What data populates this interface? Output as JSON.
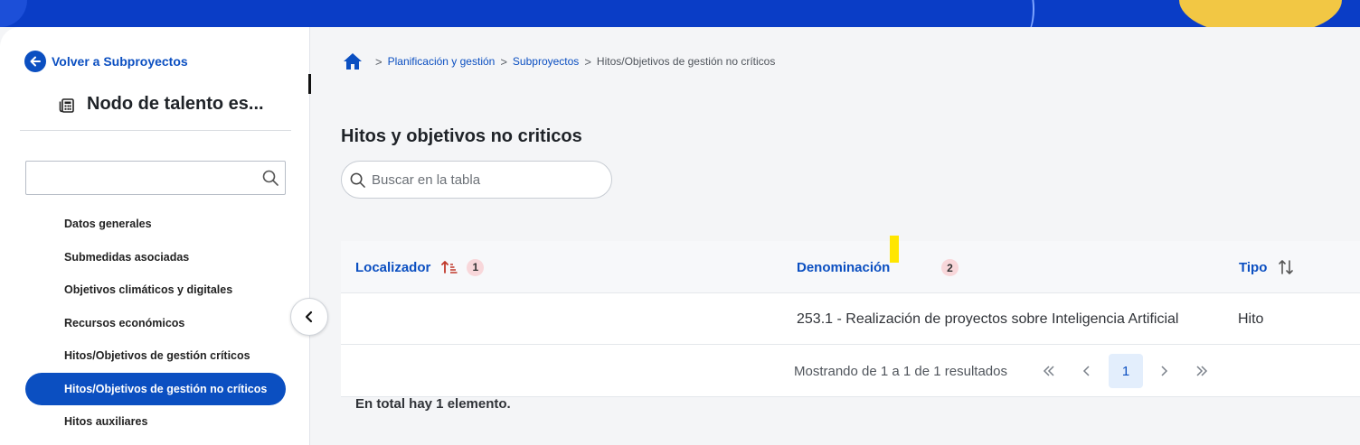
{
  "sidebar": {
    "back_label": "Volver a Subproyectos",
    "project_title": "Nodo de talento es...",
    "search_placeholder": "",
    "items": [
      {
        "label": "Datos generales"
      },
      {
        "label": "Submedidas asociadas"
      },
      {
        "label": "Objetivos climáticos y digitales"
      },
      {
        "label": "Recursos económicos"
      },
      {
        "label": "Hitos/Objetivos de gestión críticos"
      },
      {
        "label": "Hitos/Objetivos de gestión no críticos",
        "active": true
      },
      {
        "label": "Hitos auxiliares"
      }
    ]
  },
  "breadcrumb": {
    "items": [
      "Planificación y gestión",
      "Subproyectos"
    ],
    "current": "Hitos/Objetivos de gestión no críticos"
  },
  "page_title": "Hitos y objetivos no criticos",
  "table_search": {
    "placeholder": "Buscar en la tabla"
  },
  "table": {
    "columns": [
      {
        "label": "Localizador",
        "sort_order": "1"
      },
      {
        "label": "Denominación",
        "sort_order": "2"
      },
      {
        "label": "Tipo"
      }
    ],
    "rows": [
      {
        "localizador": "",
        "denominacion": "253.1 - Realización de proyectos sobre Inteligencia Artificial",
        "tipo": "Hito"
      }
    ],
    "pagination": {
      "summary": "Mostrando de 1 a 1 de 1 resultados",
      "current_page": "1"
    },
    "total_text": "En total hay 1 elemento."
  },
  "colors": {
    "primary": "#0b4fc1",
    "topbar": "#0a3dc6",
    "sort_active": "#c0392b",
    "badge_bg": "#f8d7da",
    "highlight": "#ffe600"
  }
}
